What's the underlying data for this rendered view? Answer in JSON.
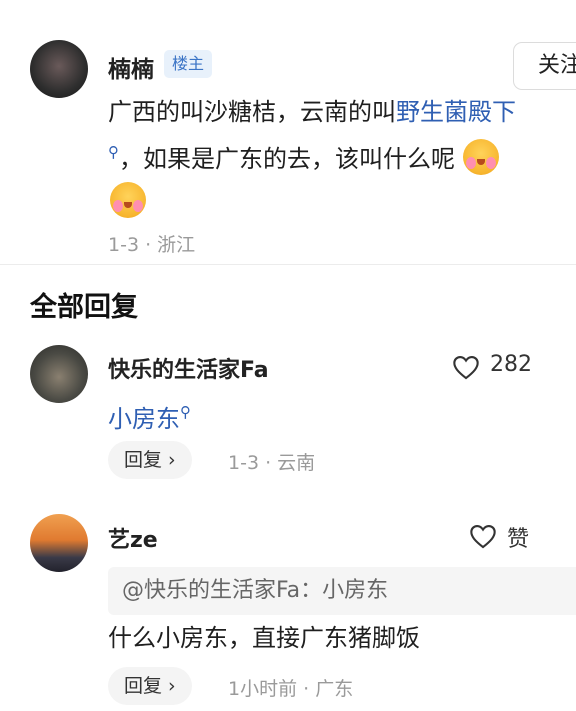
{
  "op": {
    "name": "楠楠",
    "badge": "楼主",
    "follow_label": "关注",
    "text_line1_prefix": "广西的叫沙糖桔，云南的叫",
    "text_link": "野生菌殿下",
    "text_line2": "，如果是广东的去，该叫什么呢",
    "meta": "1-3 · 浙江"
  },
  "section": {
    "all_replies": "全部回复"
  },
  "replies": [
    {
      "name": "快乐的生活家Fa",
      "like_count": "282",
      "text": "小房东",
      "reply_label": "回复 ›",
      "meta": "1-3 · 云南"
    },
    {
      "name": "艺ze",
      "like_label": "赞",
      "quote": "@快乐的生活家Fa：小房东",
      "text": "什么小房东，直接广东猪脚饭",
      "reply_label": "回复 ›",
      "meta": "1小时前 · 广东"
    }
  ]
}
